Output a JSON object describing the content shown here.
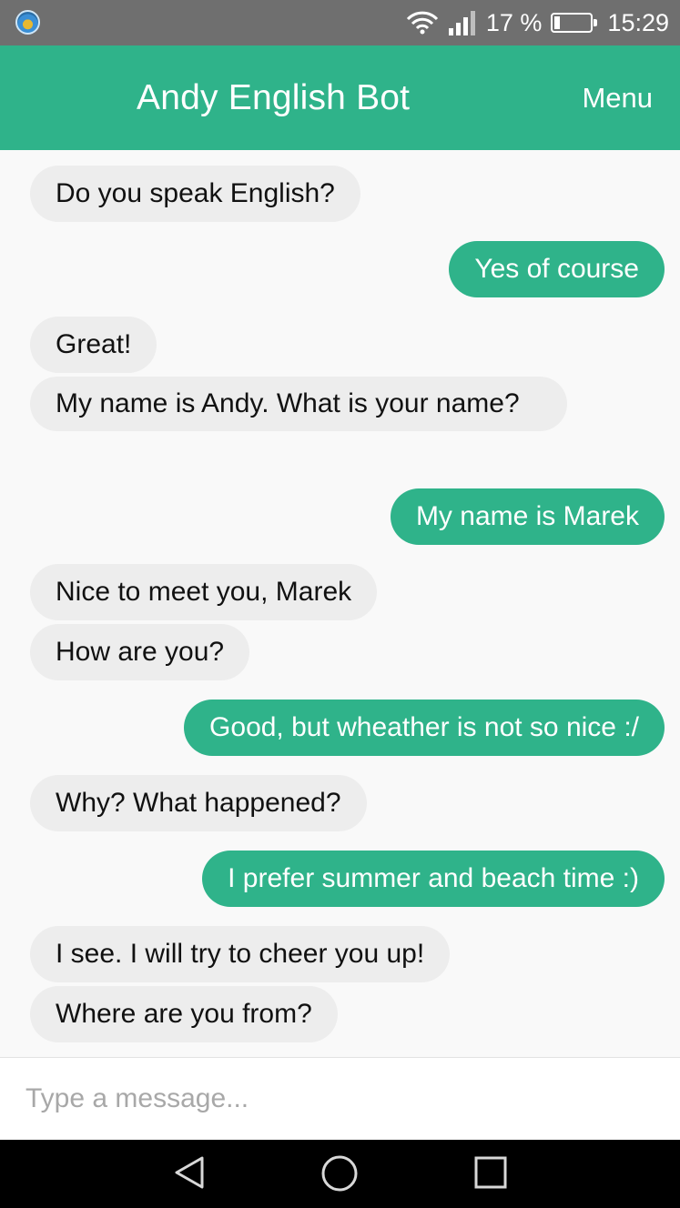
{
  "status_bar": {
    "battery_percent": "17 %",
    "time": "15:29",
    "icons": [
      "app-notification-icon",
      "wifi-icon",
      "signal-icon",
      "battery-icon"
    ]
  },
  "app_bar": {
    "title": "Andy English Bot",
    "menu_label": "Menu"
  },
  "messages": [
    {
      "sender": "bot",
      "text": "Do you speak English?"
    },
    {
      "sender": "user",
      "text": "Yes of course"
    },
    {
      "sender": "bot",
      "text": "Great!"
    },
    {
      "sender": "bot",
      "text": "My name is Andy. What is your name?"
    },
    {
      "sender": "user",
      "text": "My name is Marek"
    },
    {
      "sender": "bot",
      "text": "Nice to meet you, Marek"
    },
    {
      "sender": "bot",
      "text": "How are you?"
    },
    {
      "sender": "user",
      "text": "Good, but wheather is not so nice :/"
    },
    {
      "sender": "bot",
      "text": "Why? What happened?"
    },
    {
      "sender": "user",
      "text": "I prefer summer and beach time :)"
    },
    {
      "sender": "bot",
      "text": "I see. I will try to cheer you up!"
    },
    {
      "sender": "bot",
      "text": "Where are you from?"
    }
  ],
  "composer": {
    "placeholder": "Type a message...",
    "value": ""
  },
  "colors": {
    "accent": "#2fb38a",
    "bot_bubble": "#ededed",
    "status_bar": "#6f6f6f",
    "nav_bar": "#000000"
  },
  "nav_bar": {
    "buttons": [
      "back-icon",
      "home-icon",
      "recents-icon"
    ]
  }
}
